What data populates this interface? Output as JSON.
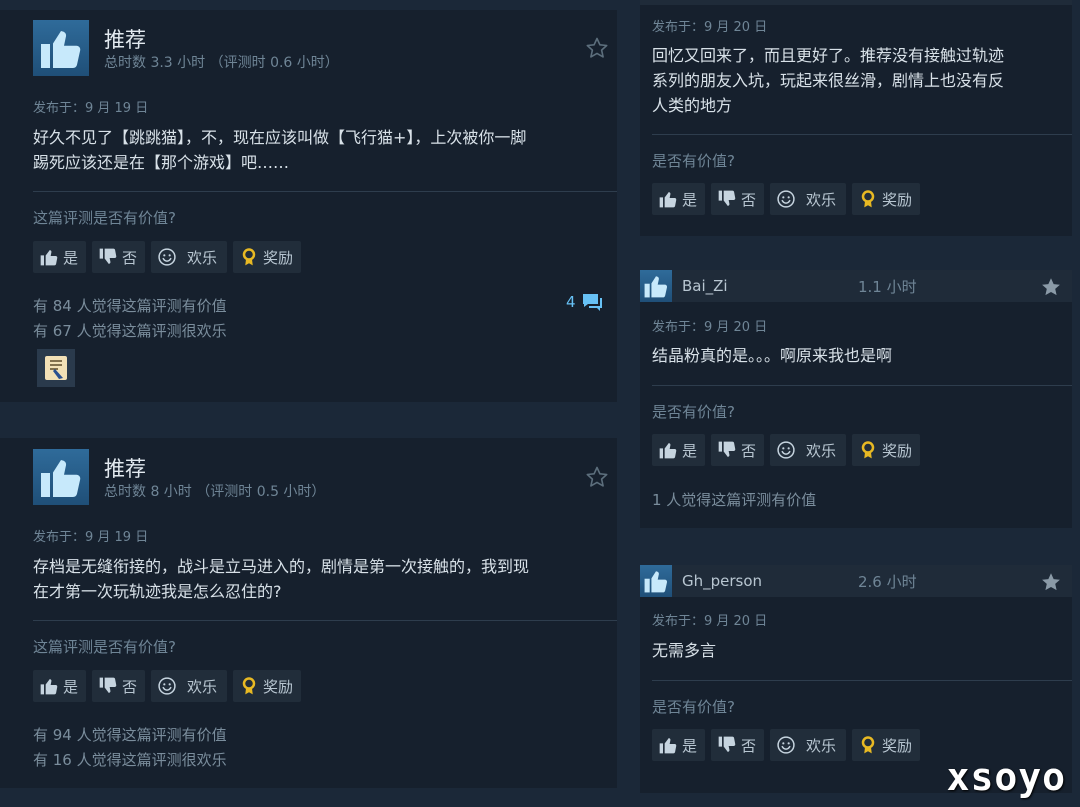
{
  "left_reviews": [
    {
      "title": "推荐",
      "hours": "总时数 3.3 小时 （评测时 0.6 小时）",
      "date": "发布于：9 月 19 日",
      "body_line1": "好久不见了【跳跳猫】，不，现在应该叫做【飞行猫+】，上次被你一脚",
      "body_line2": "踢死应该还是在【那个游戏】吧……",
      "question": "这篇评测是否有价值?",
      "btn_yes": "是",
      "btn_no": "否",
      "btn_funny": "欢乐",
      "btn_award": "奖励",
      "helpful": "有 84 人觉得这篇评测有价值",
      "funny": "有 67 人觉得这篇评测很欢乐",
      "comment_count": "4"
    },
    {
      "title": "推荐",
      "hours": "总时数 8 小时 （评测时 0.5 小时）",
      "date": "发布于：9 月 19 日",
      "body_line1": "存档是无缝衔接的，战斗是立马进入的，剧情是第一次接触的，我到现",
      "body_line2": "在才第一次玩轨迹我是怎么忍住的?",
      "question": "这篇评测是否有价值?",
      "btn_yes": "是",
      "btn_no": "否",
      "btn_funny": "欢乐",
      "btn_award": "奖励",
      "helpful": "有 94 人觉得这篇评测有价值",
      "funny": "有 16 人觉得这篇评测很欢乐"
    }
  ],
  "right_reviews": [
    {
      "date": "发布于：9 月 20 日",
      "body_line1": "回忆又回来了，而且更好了。推荐没有接触过轨迹",
      "body_line2": "系列的朋友入坑，玩起来很丝滑，剧情上也没有反",
      "body_line3": "人类的地方",
      "question": "是否有价值?",
      "btn_yes": "是",
      "btn_no": "否",
      "btn_funny": "欢乐",
      "btn_award": "奖励"
    },
    {
      "username": "Bai_Zi",
      "hours": "1.1 小时",
      "date": "发布于：9 月 20 日",
      "body_line1": "结晶粉真的是。。。啊原来我也是啊",
      "question": "是否有价值?",
      "btn_yes": "是",
      "btn_no": "否",
      "btn_funny": "欢乐",
      "btn_award": "奖励",
      "helpful": "1 人觉得这篇评测有价值"
    },
    {
      "username": "Gh_person",
      "hours": "2.6 小时",
      "date": "发布于：9 月 20 日",
      "body_line1": "无需多言",
      "question": "是否有价值?",
      "btn_yes": "是",
      "btn_no": "否",
      "btn_funny": "欢乐",
      "btn_award": "奖励"
    }
  ],
  "watermark": "xsoyo",
  "colors": {
    "background": "#1b2838",
    "card": "#16202d",
    "thumb_blue": "#67c1f5",
    "award_gold": "#e8b923"
  }
}
